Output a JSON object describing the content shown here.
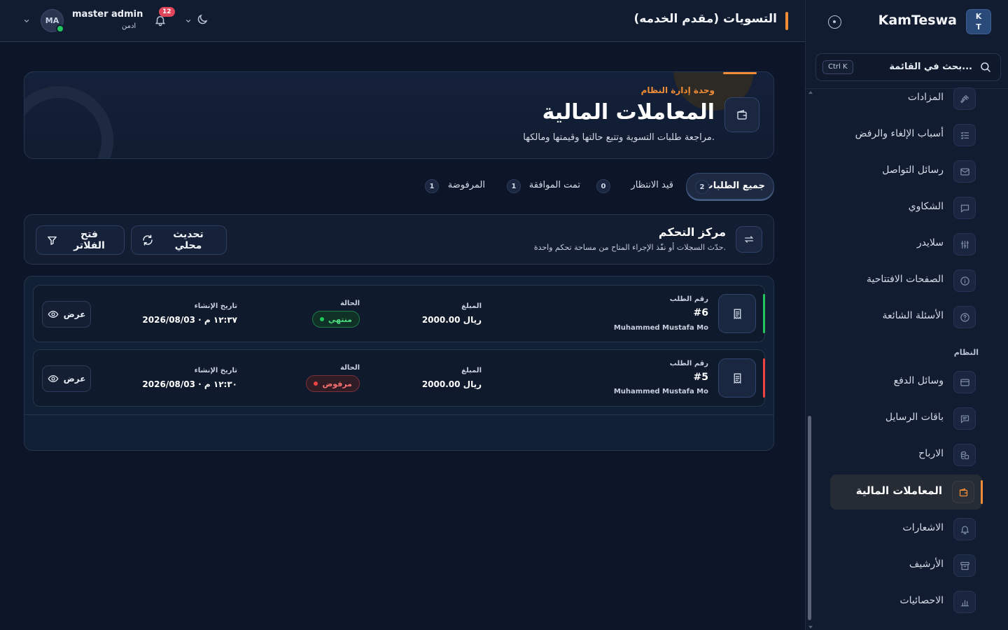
{
  "sidebar": {
    "logo_line1": "K",
    "logo_line2": "T",
    "brand": "KamTeswa",
    "search_placeholder": "بحث في القائمة...",
    "search_shortcut": "Ctrl K",
    "section_system": "النظام",
    "items": [
      {
        "label": "المزادات",
        "icon": "gavel-icon"
      },
      {
        "label": "أسباب الإلغاء والرفض",
        "icon": "list-check-icon"
      },
      {
        "label": "رسائل التواصل",
        "icon": "mail-icon"
      },
      {
        "label": "الشكاوي",
        "icon": "message-square-icon"
      },
      {
        "label": "سلايدر",
        "icon": "sliders-icon"
      },
      {
        "label": "الصفحات الافتتاحية",
        "icon": "info-icon"
      },
      {
        "label": "الأسئلة الشائعة",
        "icon": "help-circle-icon"
      },
      {
        "label": "وسائل الدفع",
        "icon": "credit-card-icon"
      },
      {
        "label": "باقات الرسايل",
        "icon": "message-icon"
      },
      {
        "label": "الارباح",
        "icon": "coins-icon"
      },
      {
        "label": "المعاملات المالية",
        "icon": "wallet-icon",
        "active": true
      },
      {
        "label": "الاشعارات",
        "icon": "bell-icon"
      },
      {
        "label": "الأرشيف",
        "icon": "archive-icon"
      },
      {
        "label": "الاحصائيات",
        "icon": "bar-chart-icon"
      }
    ]
  },
  "header": {
    "page_title": "التسويات (مقدم الخدمه)",
    "user_name": "master admin",
    "user_role": "ادمن",
    "avatar_initials": "MA",
    "notification_count": "12"
  },
  "hero": {
    "kicker": "وحدة إدارة النظام",
    "title": "المعاملات المالية",
    "description": "مراجعة طلبات التسوية وتتبع حالتها وقيمتها ومالكها."
  },
  "tabs": [
    {
      "label": "جميع الطلبات",
      "count": "2",
      "active": true
    },
    {
      "label": "قيد الانتظار",
      "count": "0"
    },
    {
      "label": "تمت الموافقة",
      "count": "1"
    },
    {
      "label": "المرفوضة",
      "count": "1"
    }
  ],
  "control": {
    "title": "مركز التحكم",
    "subtitle": "حدّث السجلات أو نفّذ الإجراء المتاح من مساحة تحكم واحدة.",
    "refresh_label": "تحديث محلي",
    "filters_label": "فتح الفلاتر"
  },
  "labels": {
    "request_number": "رقم الطلب",
    "amount": "المبلغ",
    "status": "الحالة",
    "created_at": "تاريخ الإنشاء",
    "view": "عرض"
  },
  "rows": [
    {
      "number": "#6",
      "owner": "Muhammed Mustafa Mo",
      "amount": "2000.00 ريال",
      "status": "منتهي",
      "status_type": "done",
      "accent": "#22c55e",
      "created": "2026/08/03 · ١٢:٣٧ م"
    },
    {
      "number": "#5",
      "owner": "Muhammed Mustafa Mo",
      "amount": "2000.00 ريال",
      "status": "مرفوض",
      "status_type": "rejected",
      "accent": "#ef4444",
      "created": "2026/08/03 · ١٢:٣٠ م"
    }
  ],
  "colors": {
    "accent": "#f08c36",
    "success": "#22c55e",
    "danger": "#ef4444",
    "background": "#0d1628"
  }
}
